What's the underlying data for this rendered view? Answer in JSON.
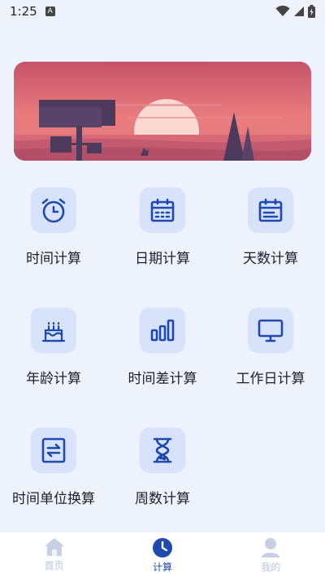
{
  "status_bar": {
    "time": "1:25",
    "badge": "A"
  },
  "tools": [
    {
      "label": "时间计算",
      "icon": "alarm-clock-icon"
    },
    {
      "label": "日期计算",
      "icon": "calendar-grid-icon"
    },
    {
      "label": "天数计算",
      "icon": "calendar-list-icon"
    },
    {
      "label": "年龄计算",
      "icon": "birthday-cake-icon"
    },
    {
      "label": "时间差计算",
      "icon": "bar-chart-icon"
    },
    {
      "label": "工作日计算",
      "icon": "monitor-icon"
    },
    {
      "label": "时间单位换算",
      "icon": "swap-arrows-icon"
    },
    {
      "label": "周数计算",
      "icon": "hourglass-icon"
    }
  ],
  "tabbar": {
    "home": "首页",
    "calc": "计算",
    "mine": "我的",
    "active": "calc"
  },
  "colors": {
    "background": "#eef2fc",
    "icon_tile": "#d8e3fb",
    "accent": "#1d4ab0",
    "inactive": "#b8c3dc"
  }
}
